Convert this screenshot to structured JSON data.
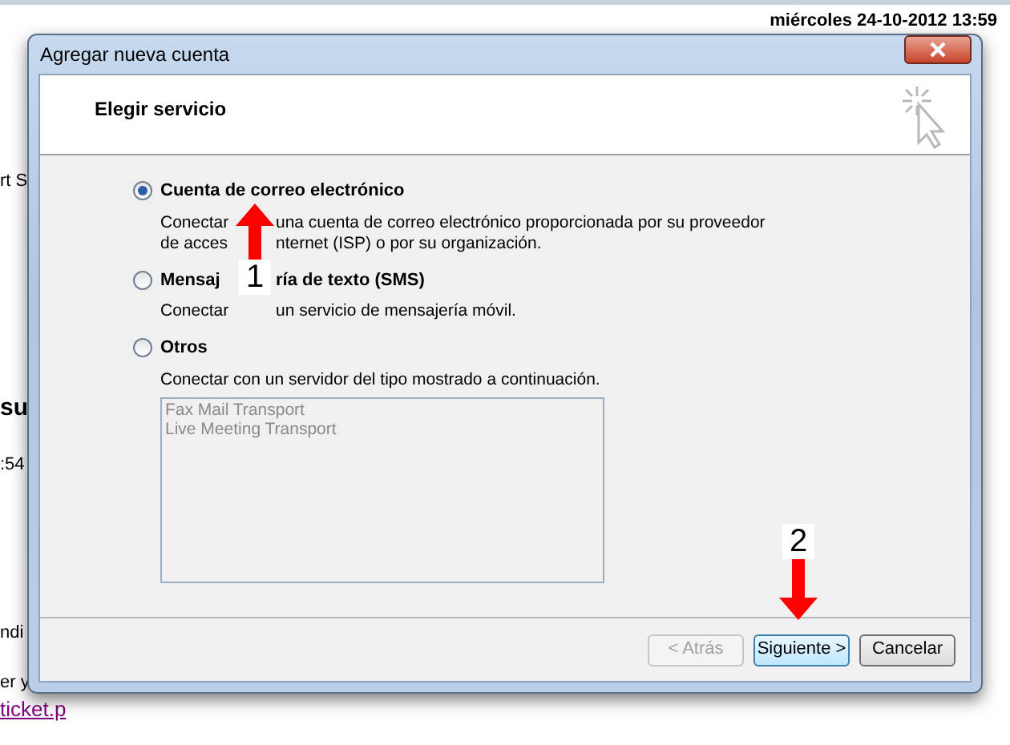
{
  "background": {
    "date": "miércoles 24-10-2012 13:59",
    "fragments": [
      {
        "kind": "plain",
        "text": "rt S"
      },
      {
        "kind": "bold",
        "text": "su"
      },
      {
        "kind": "plain",
        "text": ":54"
      },
      {
        "kind": "plain",
        "text": "ndi"
      },
      {
        "kind": "plain",
        "text": "er y"
      },
      {
        "kind": "link",
        "text": "ticket.p"
      }
    ]
  },
  "window": {
    "title": "Agregar nueva cuenta",
    "header": "Elegir servicio"
  },
  "options": [
    {
      "label": [
        "Cuenta de correo electrónico"
      ],
      "selected": true,
      "description": [
        [
          "Conectar",
          "una cuenta de correo electrónico proporcionada por su proveedor"
        ],
        [
          "de acces",
          "nternet (ISP) o por su organización."
        ]
      ]
    },
    {
      "label": [
        "Mensaj",
        "ría de texto (SMS)"
      ],
      "selected": false,
      "description": [
        [
          "Conectar",
          "un servicio de mensajería móvil."
        ]
      ]
    },
    {
      "label": [
        "Otros"
      ],
      "selected": false,
      "description": [
        [
          "Conectar con un servidor del tipo mostrado a continuación."
        ]
      ],
      "list": [
        "Fax Mail Transport",
        "Live Meeting Transport"
      ]
    }
  ],
  "buttons": [
    {
      "label": "< Atrás",
      "disabled": true,
      "selected": false
    },
    {
      "label": "Siguiente >",
      "disabled": false,
      "selected": true
    },
    {
      "label": "Cancelar",
      "disabled": false,
      "selected": false
    }
  ],
  "annotations": [
    {
      "number": "1",
      "kind": "up-arrow"
    },
    {
      "number": "2",
      "kind": "down-arrow"
    }
  ]
}
